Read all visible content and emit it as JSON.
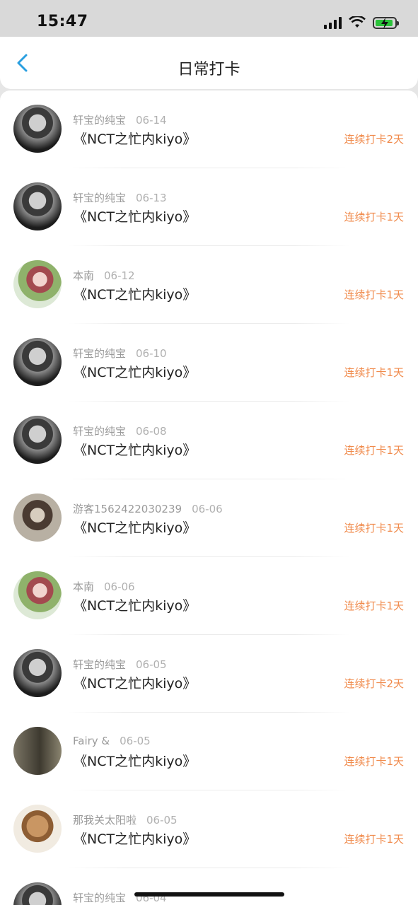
{
  "status_bar": {
    "time": "15:47"
  },
  "header": {
    "title": "日常打卡"
  },
  "list": [
    {
      "name": "轩宝的纯宝",
      "date": "06-14",
      "content": "《NCT之忙内kiyo》",
      "streak": "连续打卡2天",
      "avatar": "male"
    },
    {
      "name": "轩宝的纯宝",
      "date": "06-13",
      "content": "《NCT之忙内kiyo》",
      "streak": "连续打卡1天",
      "avatar": "male"
    },
    {
      "name": "本南",
      "date": "06-12",
      "content": "《NCT之忙内kiyo》",
      "streak": "连续打卡1天",
      "avatar": "female"
    },
    {
      "name": "轩宝的纯宝",
      "date": "06-10",
      "content": "《NCT之忙内kiyo》",
      "streak": "连续打卡1天",
      "avatar": "male"
    },
    {
      "name": "轩宝的纯宝",
      "date": "06-08",
      "content": "《NCT之忙内kiyo》",
      "streak": "连续打卡1天",
      "avatar": "male"
    },
    {
      "name": "游客1562422030239",
      "date": "06-06",
      "content": "《NCT之忙内kiyo》",
      "streak": "连续打卡1天",
      "avatar": "guest"
    },
    {
      "name": "本南",
      "date": "06-06",
      "content": "《NCT之忙内kiyo》",
      "streak": "连续打卡1天",
      "avatar": "female"
    },
    {
      "name": "轩宝的纯宝",
      "date": "06-05",
      "content": "《NCT之忙内kiyo》",
      "streak": "连续打卡2天",
      "avatar": "male"
    },
    {
      "name": "Fairy &",
      "date": "06-05",
      "content": "《NCT之忙内kiyo》",
      "streak": "连续打卡1天",
      "avatar": "fairy"
    },
    {
      "name": "那我关太阳啦",
      "date": "06-05",
      "content": "《NCT之忙内kiyo》",
      "streak": "连续打卡1天",
      "avatar": "dog"
    },
    {
      "name": "轩宝的纯宝",
      "date": "06-04",
      "content": "",
      "streak": "",
      "avatar": "male"
    }
  ],
  "colors": {
    "accent": "#f08a4b",
    "back_icon": "#2a9fe0",
    "battery": "#2bc33a"
  }
}
